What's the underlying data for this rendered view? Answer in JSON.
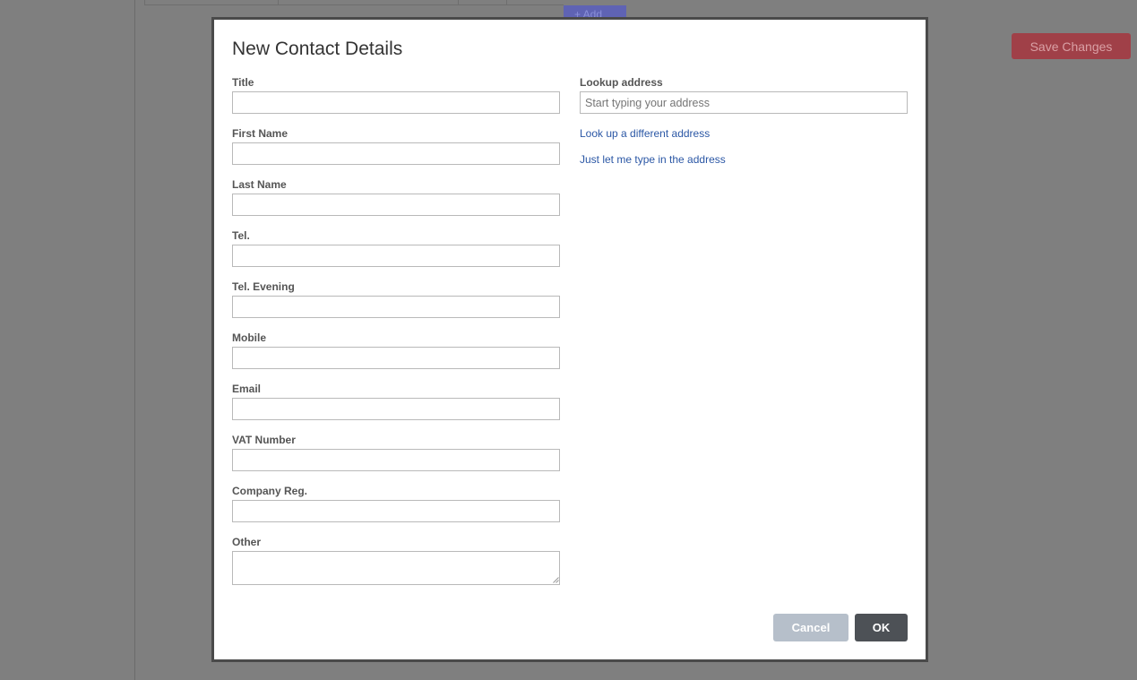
{
  "background": {
    "add_label": "+ Add",
    "save_changes_label": "Save Changes"
  },
  "modal": {
    "title": "New Contact Details",
    "fields": [
      {
        "label": "Title",
        "value": ""
      },
      {
        "label": "First Name",
        "value": ""
      },
      {
        "label": "Last Name",
        "value": ""
      },
      {
        "label": "Tel.",
        "value": ""
      },
      {
        "label": "Tel. Evening",
        "value": ""
      },
      {
        "label": "Mobile",
        "value": ""
      },
      {
        "label": "Email",
        "value": ""
      },
      {
        "label": "VAT Number",
        "value": ""
      },
      {
        "label": "Company Reg.",
        "value": ""
      },
      {
        "label": "Other",
        "value": ""
      }
    ],
    "lookup": {
      "label": "Lookup address",
      "placeholder": "Start typing your address",
      "different_address_link": "Look up a different address",
      "manual_entry_link": "Just let me type in the address"
    },
    "buttons": {
      "cancel": "Cancel",
      "ok": "OK"
    }
  },
  "colors": {
    "overlay": "#7f7f7f",
    "link": "#2b57a5",
    "save_button": "#a04048",
    "ok_button": "#4d5156",
    "cancel_button": "#b6bfca"
  }
}
